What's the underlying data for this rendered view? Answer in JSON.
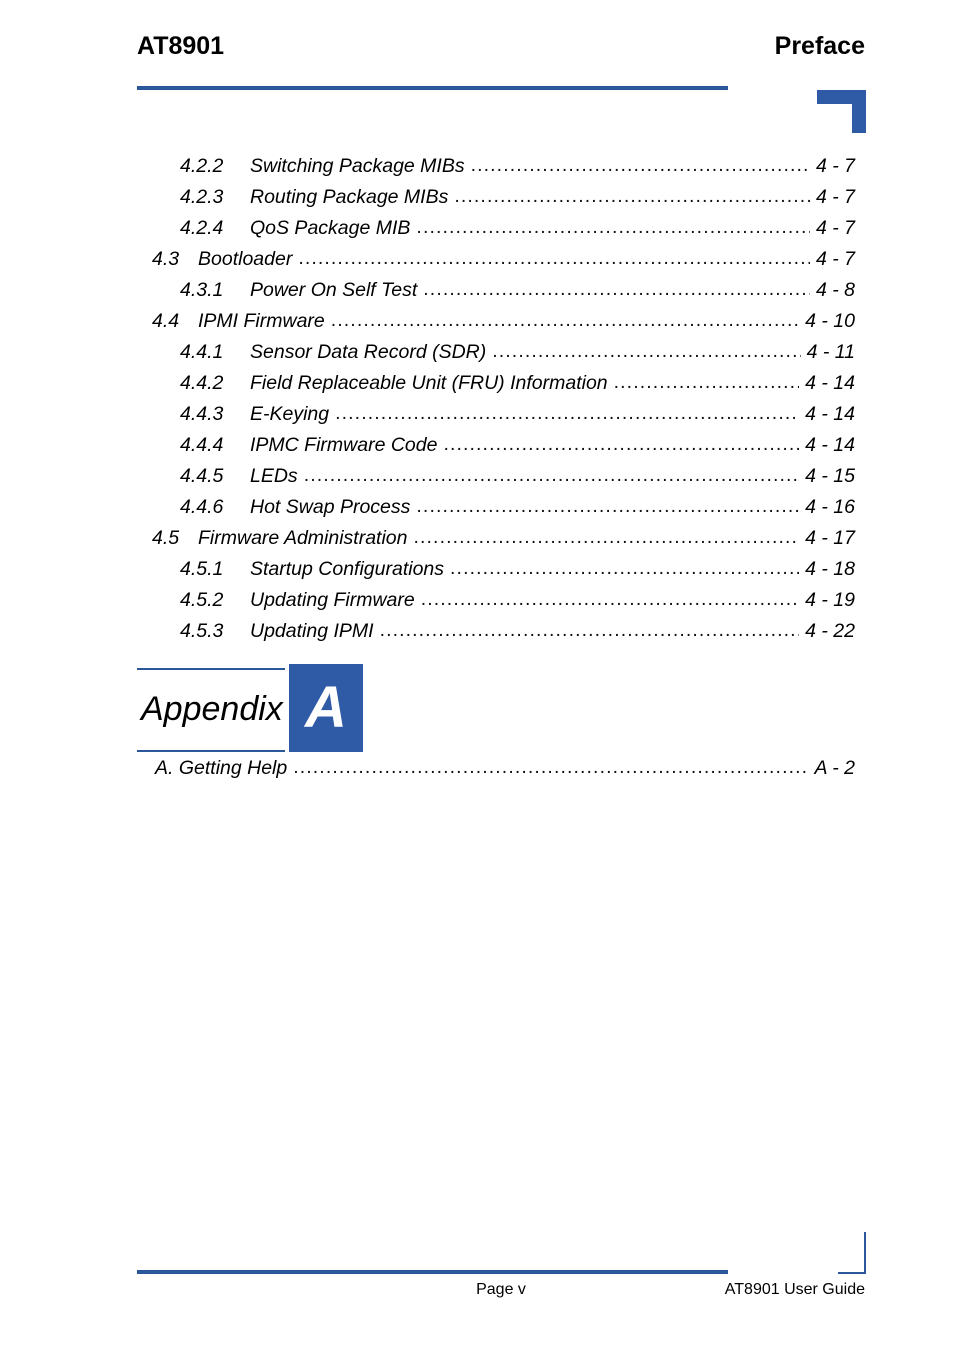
{
  "header": {
    "document_title": "AT8901",
    "section_title": "Preface",
    "rule_color": "#2b5699",
    "corner_mark_color": "#2f5aa5"
  },
  "toc": {
    "entries": [
      {
        "level": 3,
        "number": "4.2.2",
        "title": "Switching Package MIBs",
        "page": "4 - 7"
      },
      {
        "level": 3,
        "number": "4.2.3",
        "title": "Routing Package MIBs",
        "page": "4 - 7"
      },
      {
        "level": 3,
        "number": "4.2.4",
        "title": "QoS Package MIB",
        "page": "4 - 7"
      },
      {
        "level": 2,
        "number": "4.3",
        "title": "Bootloader",
        "page": "4 - 7"
      },
      {
        "level": 3,
        "number": "4.3.1",
        "title": "Power On Self Test",
        "page": "4 - 8"
      },
      {
        "level": 2,
        "number": "4.4",
        "title": "IPMI Firmware",
        "page": "4 - 10"
      },
      {
        "level": 3,
        "number": "4.4.1",
        "title": "Sensor Data Record (SDR)",
        "page": "4 - 11"
      },
      {
        "level": 3,
        "number": "4.4.2",
        "title": "Field Replaceable Unit (FRU) Information",
        "page": "4 - 14"
      },
      {
        "level": 3,
        "number": "4.4.3",
        "title": "E-Keying",
        "page": "4 - 14"
      },
      {
        "level": 3,
        "number": "4.4.4",
        "title": "IPMC Firmware Code",
        "page": "4 - 14"
      },
      {
        "level": 3,
        "number": "4.4.5",
        "title": "LEDs",
        "page": "4 - 15"
      },
      {
        "level": 3,
        "number": "4.4.6",
        "title": "Hot Swap Process",
        "page": "4 - 16"
      },
      {
        "level": 2,
        "number": "4.5",
        "title": "Firmware Administration",
        "page": "4 - 17"
      },
      {
        "level": 3,
        "number": "4.5.1",
        "title": "Startup Configurations",
        "page": "4 - 18"
      },
      {
        "level": 3,
        "number": "4.5.2",
        "title": "Updating Firmware",
        "page": "4 - 19"
      },
      {
        "level": 3,
        "number": "4.5.3",
        "title": "Updating IPMI",
        "page": "4 - 22"
      }
    ]
  },
  "appendix": {
    "label": "Appendix",
    "letter": "A",
    "box_color": "#2f5aa5",
    "rule_color": "#2b5699",
    "entries": [
      {
        "level": 1,
        "number": "",
        "title": "A. Getting Help",
        "page": "A - 2"
      }
    ]
  },
  "footer": {
    "page_label": "Page v",
    "guide_label": "AT8901 User Guide",
    "rule_color": "#2b5699"
  }
}
